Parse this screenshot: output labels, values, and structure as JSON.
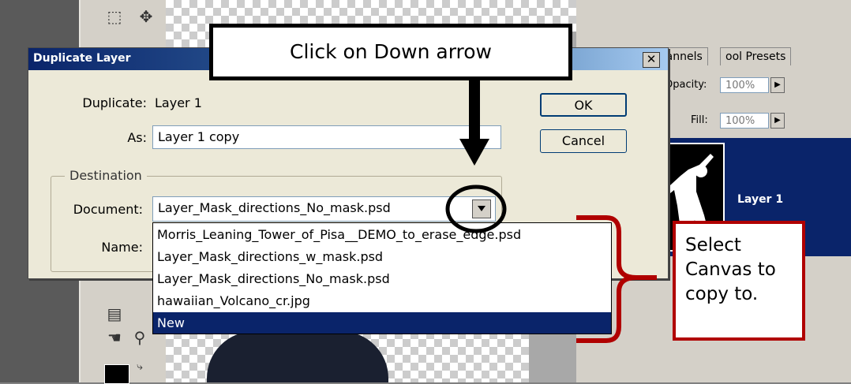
{
  "dialog": {
    "title": "Duplicate Layer",
    "close_glyph": "✕",
    "duplicate_label": "Duplicate:",
    "duplicate_value": "Layer 1",
    "as_label": "As:",
    "as_value": "Layer 1 copy",
    "ok_label": "OK",
    "cancel_label": "Cancel",
    "destination_legend": "Destination",
    "document_label": "Document:",
    "document_value": "Layer_Mask_directions_No_mask.psd",
    "name_label": "Name:"
  },
  "dropdown": {
    "options": [
      "Morris_Leaning_Tower_of_Pisa__DEMO_to_erase_edge.psd",
      "Layer_Mask_directions_w_mask.psd",
      "Layer_Mask_directions_No_mask.psd",
      "hawaiian_Volcano_cr.jpg",
      "New"
    ],
    "selected": "New"
  },
  "layers_panel": {
    "tab_channels": "Channels",
    "tab_tool_presets": "ool Presets",
    "opacity_label": "Opacity:",
    "opacity_value": "100%",
    "fill_label": "Fill:",
    "fill_value": "100%",
    "layer_name": "Layer 1"
  },
  "annotations": {
    "top_callout": "Click on Down arrow",
    "right_callout": "Select Canvas to copy to."
  },
  "colors": {
    "title_bar": "#0a246a",
    "selection": "#0a246a",
    "callout_red": "#b00000",
    "dialog_bg": "#ece9d8"
  }
}
